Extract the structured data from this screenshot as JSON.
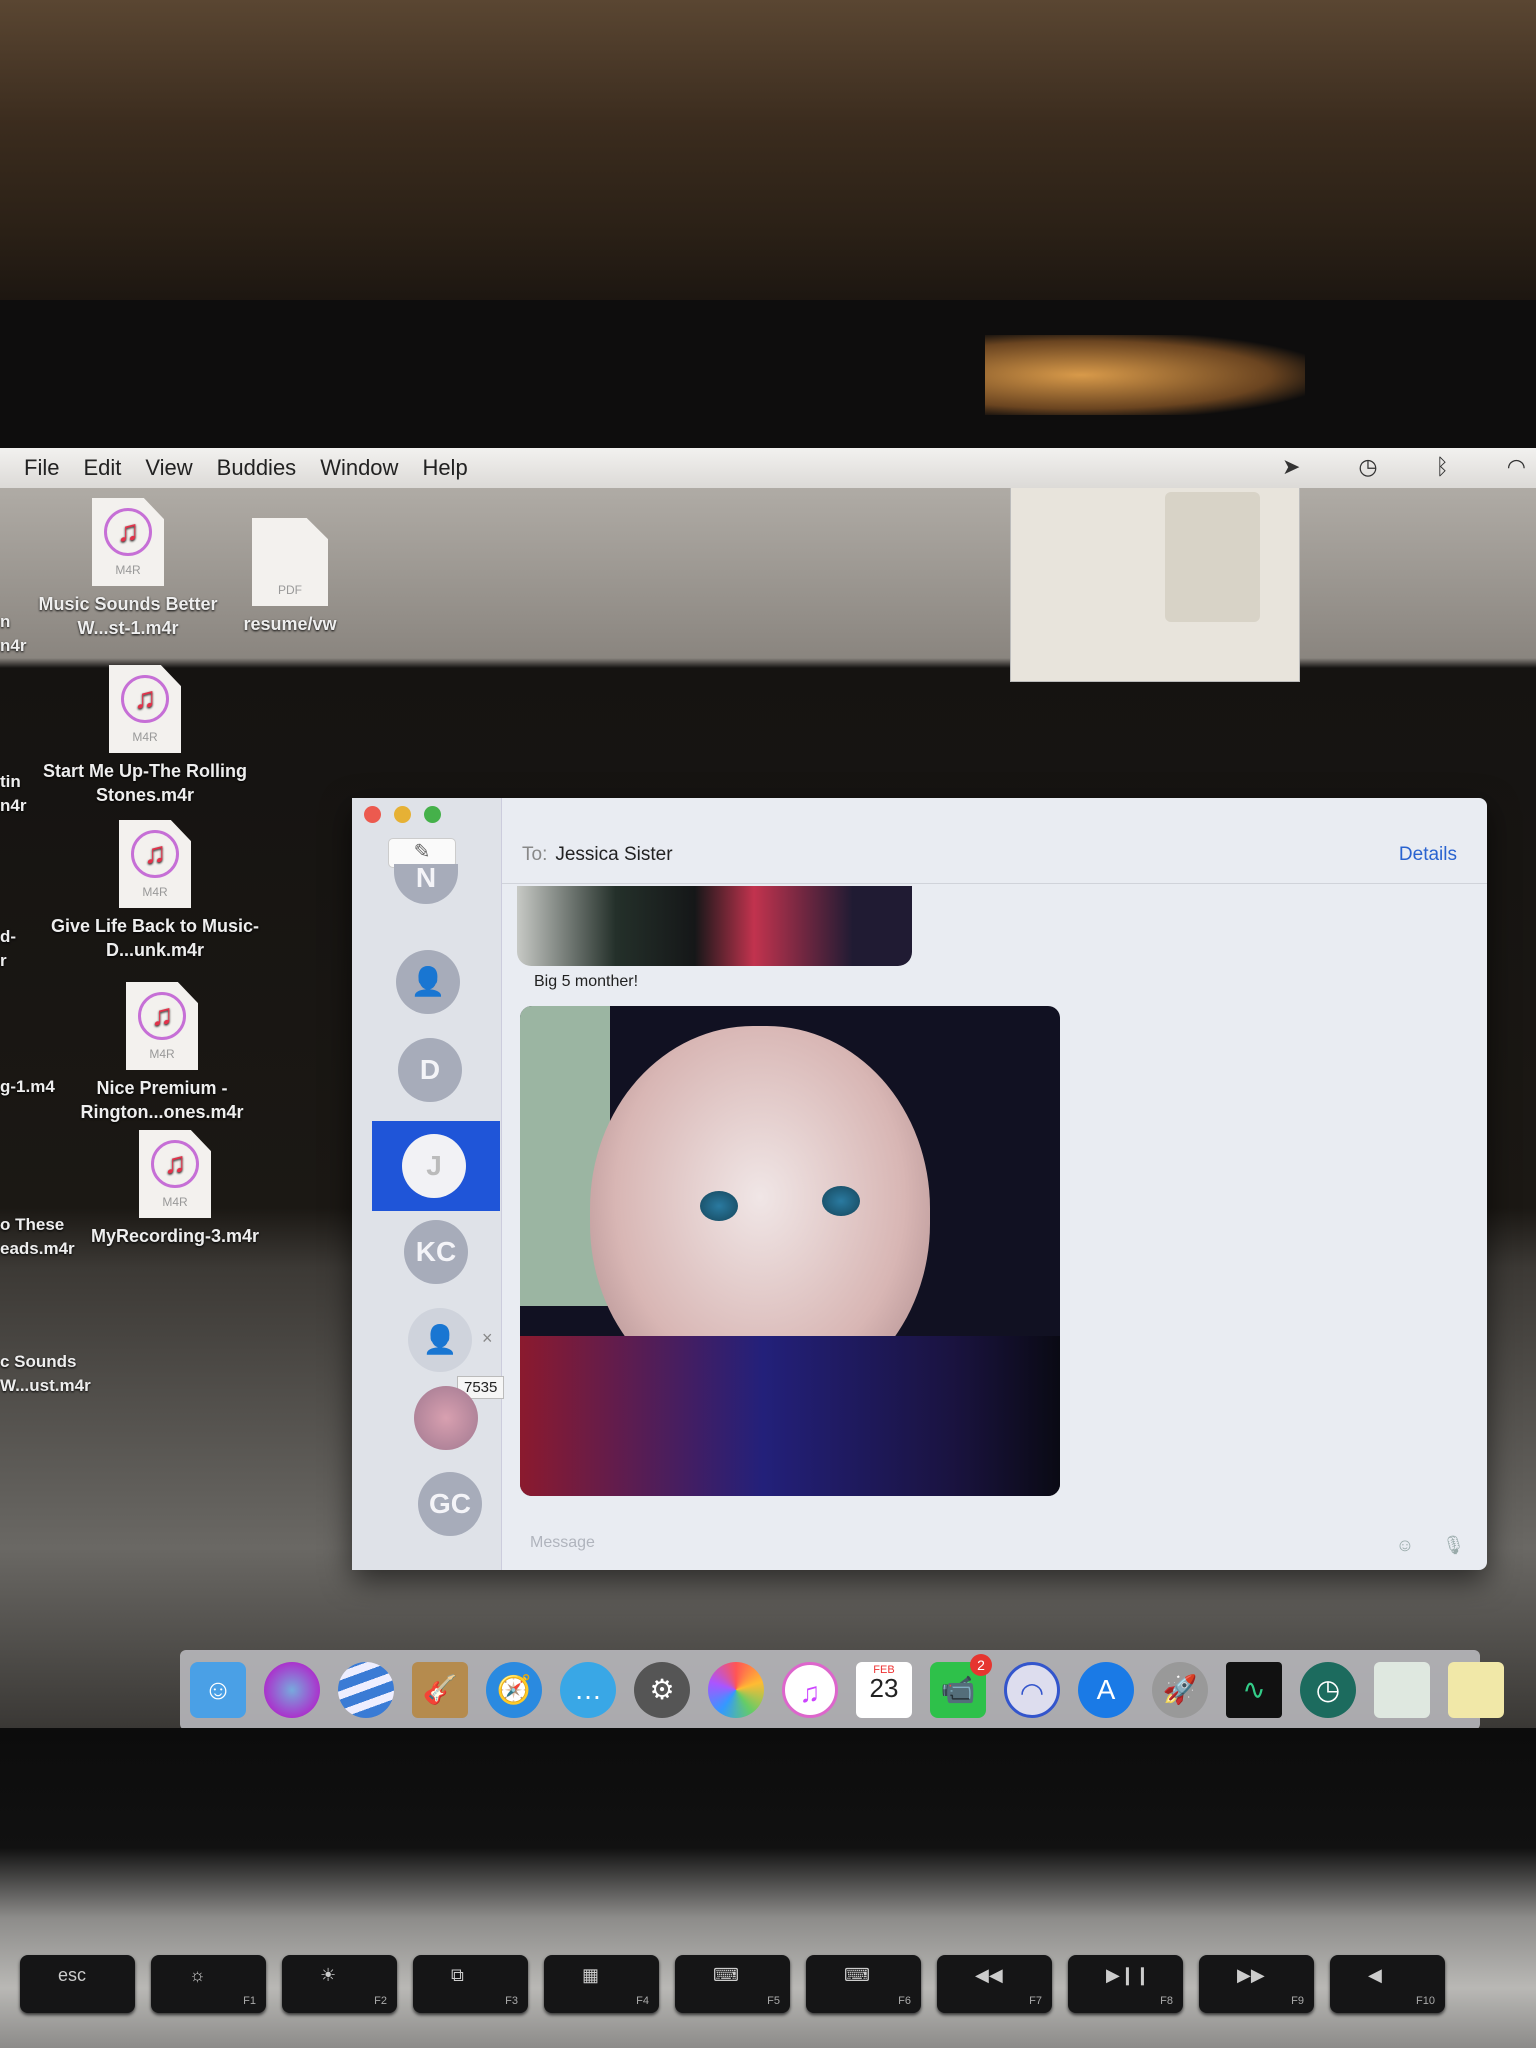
{
  "menubar": {
    "items": [
      "File",
      "Edit",
      "View",
      "Buddies",
      "Window",
      "Help"
    ],
    "status_icons": [
      "location-arrow-icon",
      "time-machine-icon",
      "bluetooth-icon",
      "wifi-icon"
    ]
  },
  "desktop": {
    "files": [
      {
        "name": "Music Sounds Better W...st-1.m4r",
        "ext": "M4R"
      },
      {
        "name": "resume/vw",
        "ext": "PDF"
      },
      {
        "name": "Start Me Up-The Rolling Stones.m4r",
        "ext": "M4R"
      },
      {
        "name": "Give Life Back to Music-D...unk.m4r",
        "ext": "M4R"
      },
      {
        "name": "Nice Premium - Rington...ones.m4r",
        "ext": "M4R"
      },
      {
        "name": "MyRecording-3.m4r",
        "ext": "M4R"
      }
    ],
    "partial_labels": [
      "n\nn4r",
      "tin\nn4r",
      "d-\nr",
      "g-1.m4",
      "o These\neads.m4r",
      "c Sounds\nW...ust.m4r"
    ]
  },
  "messages": {
    "to_label": "To:",
    "recipient": "Jessica Sister",
    "details": "Details",
    "conversations": [
      {
        "initials": "N"
      },
      {
        "initials": "",
        "icon": "person-icon"
      },
      {
        "initials": "D"
      },
      {
        "initials": "J",
        "selected": true
      },
      {
        "initials": "KC"
      },
      {
        "initials": "",
        "icon": "person-icon"
      },
      {
        "initials": "",
        "icon": "photo-avatar"
      },
      {
        "initials": "GC"
      }
    ],
    "tooltip": "7535",
    "caption": "Big 5 monther!",
    "input_placeholder": "Message"
  },
  "dock": {
    "apps": [
      "Finder",
      "Siri",
      "Google Earth",
      "GarageBand",
      "Safari",
      "Messages",
      "System Preferences",
      "Photos",
      "iTunes",
      "Calendar",
      "FaceTime",
      "AirDrop",
      "App Store",
      "Launchpad",
      "Activity Monitor",
      "Time Machine",
      "Preview",
      "Notes"
    ],
    "calendar_month": "FEB",
    "calendar_day": "23",
    "facetime_badge": "2"
  },
  "keyboard": {
    "keys": [
      {
        "label": "esc",
        "fn": ""
      },
      {
        "label": "☼",
        "fn": "F1"
      },
      {
        "label": "☀",
        "fn": "F2"
      },
      {
        "label": "⧉",
        "fn": "F3"
      },
      {
        "label": "▦",
        "fn": "F4"
      },
      {
        "label": "⌨",
        "fn": "F5"
      },
      {
        "label": "⌨",
        "fn": "F6"
      },
      {
        "label": "◀◀",
        "fn": "F7"
      },
      {
        "label": "▶❙❙",
        "fn": "F8"
      },
      {
        "label": "▶▶",
        "fn": "F9"
      },
      {
        "label": "◀",
        "fn": "F10"
      }
    ]
  }
}
